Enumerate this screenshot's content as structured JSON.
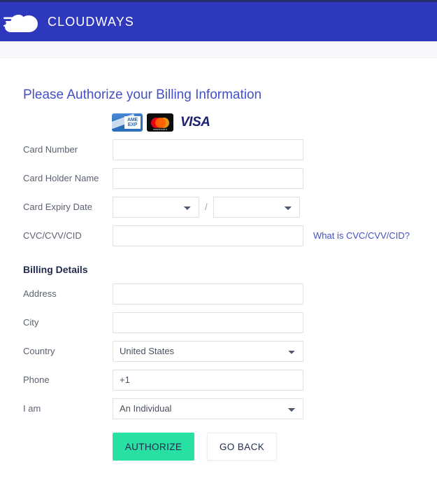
{
  "header": {
    "logo_icon": "cloudways-cloud-icon",
    "brand": "CLOUDWAYS"
  },
  "main": {
    "title": "Please Authorize your Billing Information",
    "accepted_cards": [
      {
        "name": "amex",
        "label_top": "AME",
        "label_bottom": "EXP",
        "word": "AMEX"
      },
      {
        "name": "mastercard",
        "word": "mastercard"
      },
      {
        "name": "visa",
        "word": "VISA"
      }
    ],
    "card_section": {
      "fields": [
        {
          "name": "card-number",
          "label": "Card Number",
          "type": "text",
          "value": "",
          "placeholder": ""
        },
        {
          "name": "card-holder-name",
          "label": "Card Holder Name",
          "type": "text",
          "value": "",
          "placeholder": ""
        }
      ],
      "expiry": {
        "label": "Card Expiry Date",
        "month_value": "",
        "year_value": "",
        "separator": "/"
      },
      "cvc": {
        "label": "CVC/CVV/CID",
        "value": "",
        "placeholder": "",
        "help_link": "What is CVC/CVV/CID?"
      }
    },
    "billing_section": {
      "heading": "Billing Details",
      "address": {
        "label": "Address",
        "value": "",
        "placeholder": ""
      },
      "city": {
        "label": "City",
        "value": "",
        "placeholder": ""
      },
      "country": {
        "label": "Country",
        "value": "United States"
      },
      "phone": {
        "label": "Phone",
        "value": "+1",
        "placeholder": ""
      },
      "i_am": {
        "label": "I am",
        "value": "An Individual"
      }
    },
    "actions": {
      "authorize": "AUTHORIZE",
      "go_back": "GO BACK"
    }
  },
  "colors": {
    "header_blue": "#2e38bd",
    "title_blue": "#4350c4",
    "authorize_green": "#28e0a1",
    "dark_navy": "#1f2a4d"
  }
}
